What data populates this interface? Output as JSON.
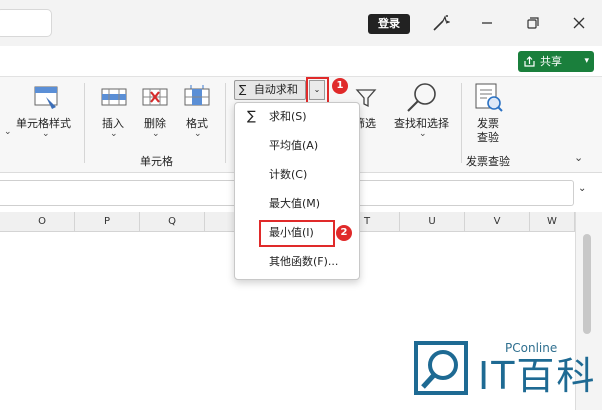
{
  "titlebar": {
    "login_label": "登录"
  },
  "share": {
    "label": "共享",
    "icon": "share-icon"
  },
  "ribbon": {
    "cell_style_label": "单元格样式",
    "insert_label": "插入",
    "delete_label": "删除",
    "format_label": "格式",
    "cells_group_label": "单元格",
    "filter_label": "筛选",
    "find_select_label": "查找和选择",
    "invoice_label_line1": "发票",
    "invoice_label_line2": "查验",
    "invoice_group_label": "发票查验",
    "autosum_label": "自动求和",
    "autosum_icon_glyph": "∑"
  },
  "columns": [
    "O",
    "P",
    "Q",
    "",
    "T",
    "U",
    "V",
    "W"
  ],
  "menu": {
    "items": [
      {
        "label": "求和(S)",
        "icon": "∑"
      },
      {
        "label": "平均值(A)"
      },
      {
        "label": "计数(C)"
      },
      {
        "label": "最大值(M)"
      },
      {
        "label": "最小值(I)"
      },
      {
        "label": "其他函数(F)..."
      }
    ]
  },
  "annotations": {
    "step1": "1",
    "step2": "2",
    "highlight_color": "#e02a2a"
  },
  "watermark": {
    "brand": "PConline",
    "site": "IT百科"
  },
  "colors": {
    "share_green": "#1a7f3c",
    "ribbon_bg": "#f7f7f7"
  }
}
